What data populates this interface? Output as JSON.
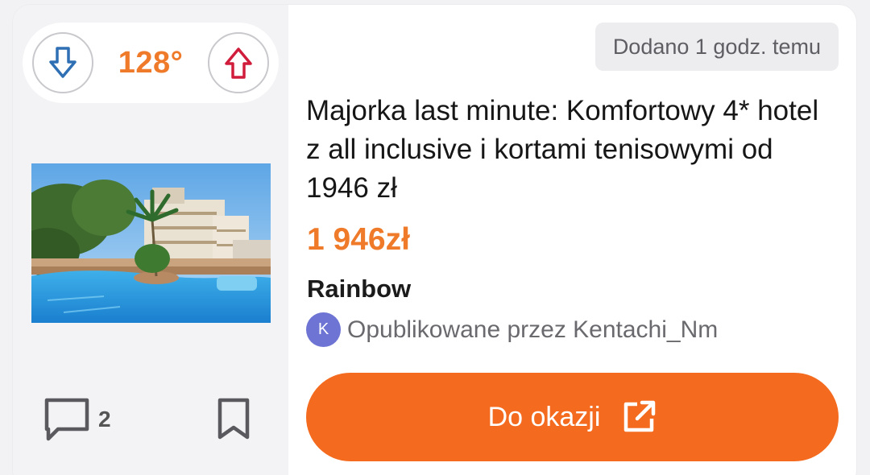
{
  "vote": {
    "temperature": "128°",
    "downvote_color": "#2f6fb3",
    "upvote_color": "#d11d3c"
  },
  "deal": {
    "added": "Dodano 1 godz. temu",
    "title": "Majorka last minute: Komfortowy 4* hotel z all inclusive i kortami tenisowymi od 1946 zł",
    "price": "1 946zł",
    "merchant": "Rainbow",
    "poster_initial": "K",
    "poster_text": "Opublikowane przez Kentachi_Nm",
    "accent": "#ef7a2a"
  },
  "actions": {
    "comments_count": "2",
    "cta_label": "Do okazji",
    "cta_color": "#f46b1f"
  },
  "icons": {
    "downvote": "arrow-down-icon",
    "upvote": "arrow-up-icon",
    "comment": "comment-icon",
    "bookmark": "bookmark-icon",
    "external": "external-link-icon"
  }
}
